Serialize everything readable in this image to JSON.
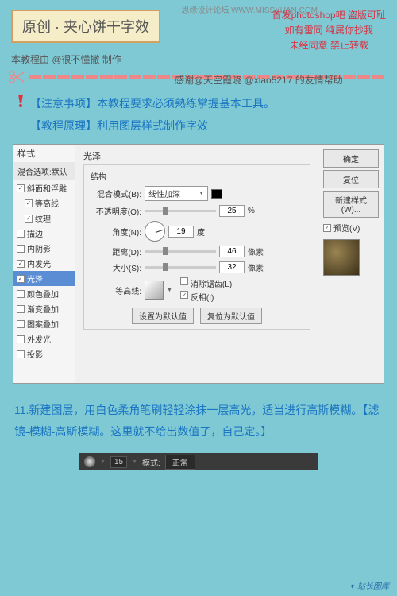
{
  "watermark": "思缘设计论坛  WWW.MISSYUAN.COM",
  "title": "原创 · 夹心饼干字效",
  "top_right": {
    "l1": "首发photoshop吧  盗版可耻",
    "l2": "如有雷同  纯属你抄我",
    "l3": "未经同意  禁止转载"
  },
  "credit": "本教程由 @很不懂撒 制作",
  "thanks": "感谢@天空霞晓  @xiao5217 的友情帮助",
  "note1": "【注意事项】本教程要求必须熟练掌握基本工具。",
  "note2": "【教程原理】利用图层样式制作字效",
  "dialog": {
    "left_header": "样式",
    "blend_default": "混合选项:默认",
    "styles": [
      {
        "label": "斜面和浮雕",
        "checked": true
      },
      {
        "label": "等高线",
        "checked": true
      },
      {
        "label": "纹理",
        "checked": true
      },
      {
        "label": "描边",
        "checked": false
      },
      {
        "label": "内阴影",
        "checked": false
      },
      {
        "label": "内发光",
        "checked": true
      },
      {
        "label": "光泽",
        "checked": true,
        "selected": true
      },
      {
        "label": "颜色叠加",
        "checked": false
      },
      {
        "label": "渐变叠加",
        "checked": false
      },
      {
        "label": "图案叠加",
        "checked": false
      },
      {
        "label": "外发光",
        "checked": false
      },
      {
        "label": "投影",
        "checked": false
      }
    ],
    "panel_title": "光泽",
    "structure": "结构",
    "blend_mode_label": "混合模式(B):",
    "blend_mode_value": "线性加深",
    "opacity_label": "不透明度(O):",
    "opacity_value": "25",
    "opacity_unit": "%",
    "angle_label": "角度(N):",
    "angle_value": "19",
    "angle_unit": "度",
    "distance_label": "距离(D):",
    "distance_value": "46",
    "distance_unit": "像素",
    "size_label": "大小(S):",
    "size_value": "32",
    "size_unit": "像素",
    "contour_label": "等高线:",
    "antialias": "消除锯齿(L)",
    "invert": "反相(I)",
    "reset_default": "设置为默认值",
    "restore_default": "复位为默认值",
    "ok": "确定",
    "cancel": "复位",
    "new_style": "新建样式(W)...",
    "preview": "预览(V)"
  },
  "instruction": "11.新建图层，用白色柔角笔刷轻轻涂抹一层高光，适当进行高斯模糊。【滤镜-模糊-高斯模糊。这里就不给出数值了，自己定。】",
  "bottom_bar": {
    "size": "15",
    "mode_label": "模式:",
    "mode_value": "正常"
  },
  "footer": "站长图库"
}
